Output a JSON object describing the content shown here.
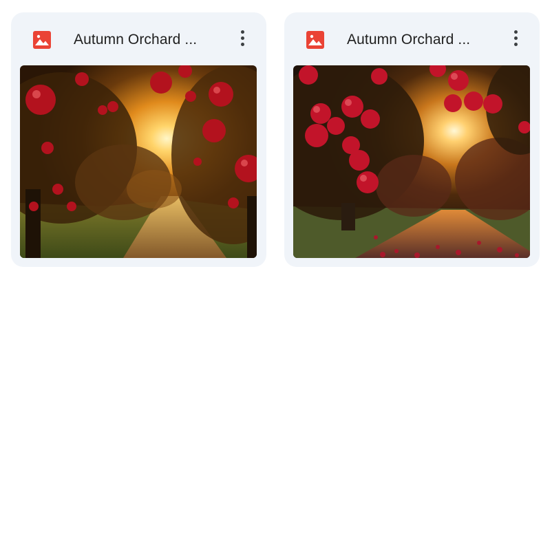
{
  "files": [
    {
      "name": "Autumn Orchard ...",
      "icon": "image-file-icon",
      "menu_icon": "more-vert-icon",
      "thumbnail": "orchard-sunset-image"
    },
    {
      "name": "Autumn Orchard ...",
      "icon": "image-file-icon",
      "menu_icon": "more-vert-icon",
      "thumbnail": "orchard-path-image"
    }
  ],
  "colors": {
    "card_bg": "#f0f4f9",
    "icon_red": "#ea4335",
    "title_text": "#1f1f1f",
    "menu_dots": "#3c4043"
  }
}
